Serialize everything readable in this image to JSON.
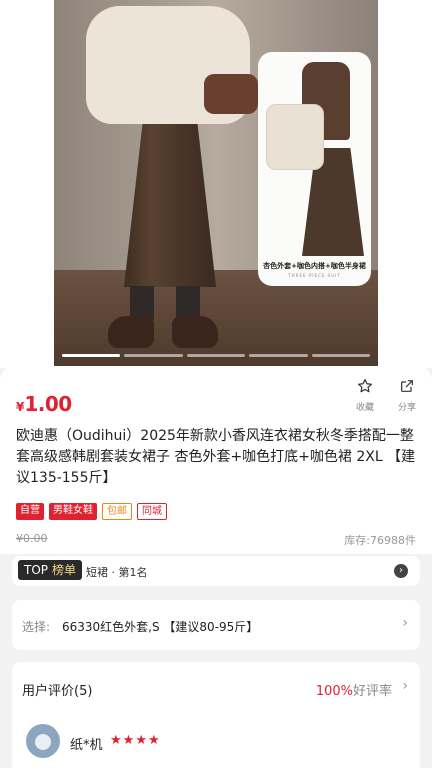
{
  "gallery": {
    "card_caption": "杏色外套+咖色内搭+咖色半身裙",
    "card_sub": "THREE-PIECE SUIT",
    "slide_count": 5,
    "active_slide": 1
  },
  "product": {
    "currency": "¥",
    "price": "1.00",
    "title": "欧迪惠（Oudihui）2025年新款小香风连衣裙女秋冬季搭配一整套高级感韩剧套装女裙子 杏色外套+咖色打底+咖色裙 2XL 【建议135-155斤】",
    "original_price": "¥0.00",
    "stock": "库存:76988件",
    "tags": [
      "自营",
      "男鞋女鞋",
      "包邮",
      "同城"
    ]
  },
  "actions": {
    "favorite_label": "收藏",
    "share_label": "分享"
  },
  "rank": {
    "badge_top": "TOP",
    "badge_label": "榜单",
    "text": "短裙 · 第1名"
  },
  "spec": {
    "label": "选择:",
    "value": "66330红色外套,S 【建议80-95斤】"
  },
  "reviews": {
    "heading": "用户评价(5)",
    "good_rate": "100%",
    "good_rate_label": "好评率",
    "first_user": "纸*机",
    "first_rating": 4
  },
  "colors": {
    "accent": "#e0212f",
    "tag_orange": "#e58a16",
    "rank_gold": "#f6d58a"
  }
}
